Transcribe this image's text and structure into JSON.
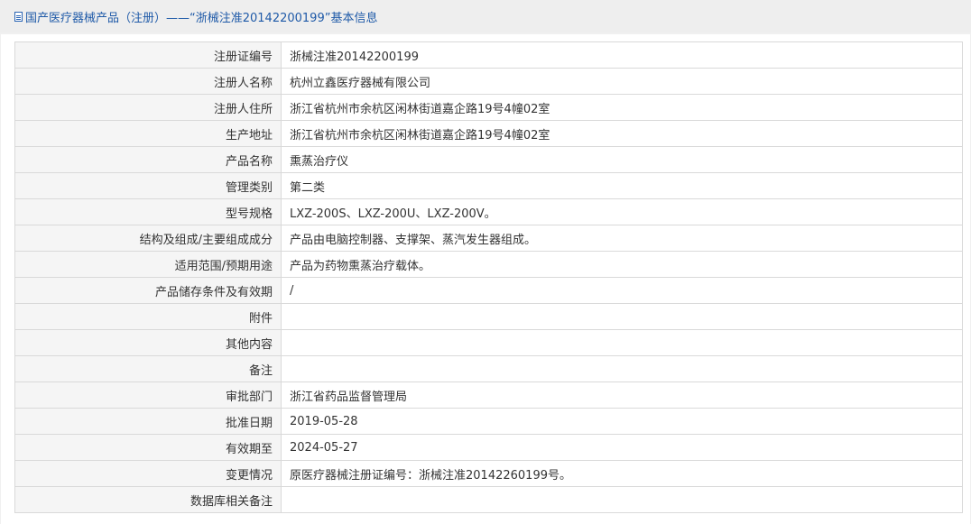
{
  "header": {
    "title": "国产医疗器械产品（注册）——“浙械注准20142200199”基本信息",
    "icon": "document-icon"
  },
  "rows": [
    {
      "label": "注册证编号",
      "value": "浙械注准20142200199"
    },
    {
      "label": "注册人名称",
      "value": "杭州立鑫医疗器械有限公司"
    },
    {
      "label": "注册人住所",
      "value": "浙江省杭州市余杭区闲林街道嘉企路19号4幢02室"
    },
    {
      "label": "生产地址",
      "value": "浙江省杭州市余杭区闲林街道嘉企路19号4幢02室"
    },
    {
      "label": "产品名称",
      "value": "熏蒸治疗仪"
    },
    {
      "label": "管理类别",
      "value": "第二类"
    },
    {
      "label": "型号规格",
      "value": "LXZ-200S、LXZ-200U、LXZ-200V。"
    },
    {
      "label": "结构及组成/主要组成成分",
      "value": "产品由电脑控制器、支撑架、蒸汽发生器组成。"
    },
    {
      "label": "适用范围/预期用途",
      "value": "产品为药物熏蒸治疗载体。"
    },
    {
      "label": "产品储存条件及有效期",
      "value": "/"
    },
    {
      "label": "附件",
      "value": ""
    },
    {
      "label": "其他内容",
      "value": ""
    },
    {
      "label": "备注",
      "value": ""
    },
    {
      "label": "审批部门",
      "value": "浙江省药品监督管理局"
    },
    {
      "label": "批准日期",
      "value": "2019-05-28"
    },
    {
      "label": "有效期至",
      "value": "2024-05-27"
    },
    {
      "label": "变更情况",
      "value": "原医疗器械注册证编号：浙械注准20142260199号。"
    },
    {
      "label": "数据库相关备注",
      "value": ""
    }
  ]
}
